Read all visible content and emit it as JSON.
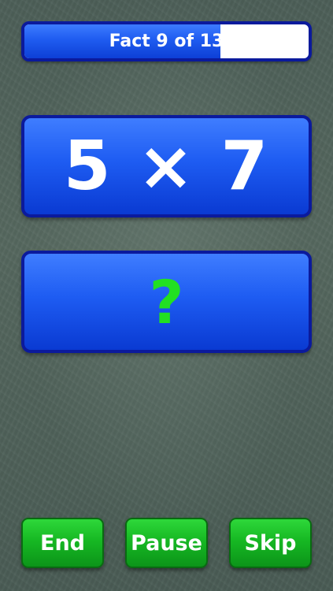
{
  "progress": {
    "label": "Fact 9 of 13",
    "current": 9,
    "total": 13,
    "fraction": 0.69
  },
  "question": {
    "text": "5 × 7"
  },
  "answer": {
    "text": "?"
  },
  "buttons": {
    "end": "End",
    "pause": "Pause",
    "skip": "Skip"
  },
  "colors": {
    "panel_blue": "#1e5cf2",
    "panel_border": "#0b1a9c",
    "answer_green": "#22e022",
    "button_green": "#16b823",
    "chalkboard": "#52645c"
  }
}
